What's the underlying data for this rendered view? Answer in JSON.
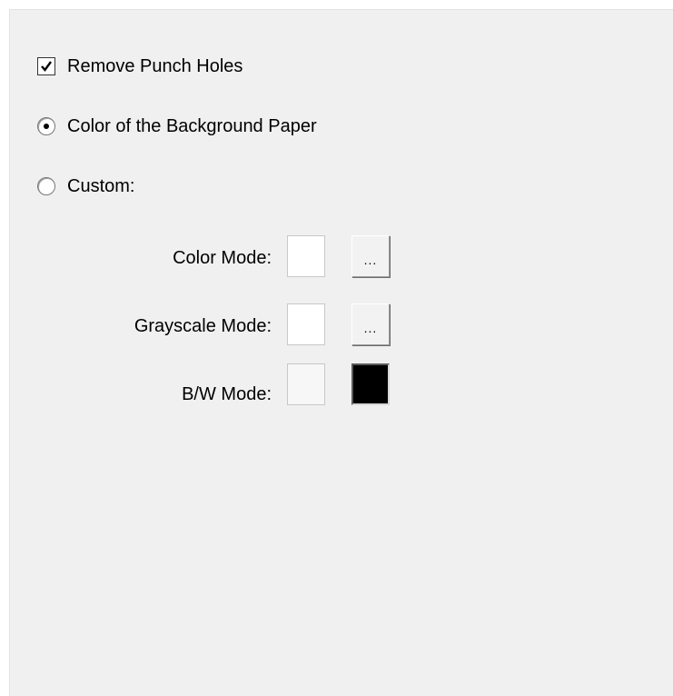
{
  "options": {
    "remove_punch_holes": {
      "label": "Remove Punch Holes",
      "checked": true
    },
    "color_background_paper": {
      "label": "Color of the Background Paper",
      "selected": true
    },
    "custom": {
      "label": "Custom:",
      "selected": false
    }
  },
  "modes": {
    "color": {
      "label": "Color Mode:",
      "swatch_color": "#ffffff",
      "button_label": "..."
    },
    "grayscale": {
      "label": "Grayscale Mode:",
      "swatch_color": "#ffffff",
      "button_label": "..."
    },
    "bw": {
      "label": "B/W Mode:",
      "swatch_color": "#f7f7f7",
      "selected_color": "#000000"
    }
  },
  "icons": {
    "checkmark": "check-icon"
  }
}
